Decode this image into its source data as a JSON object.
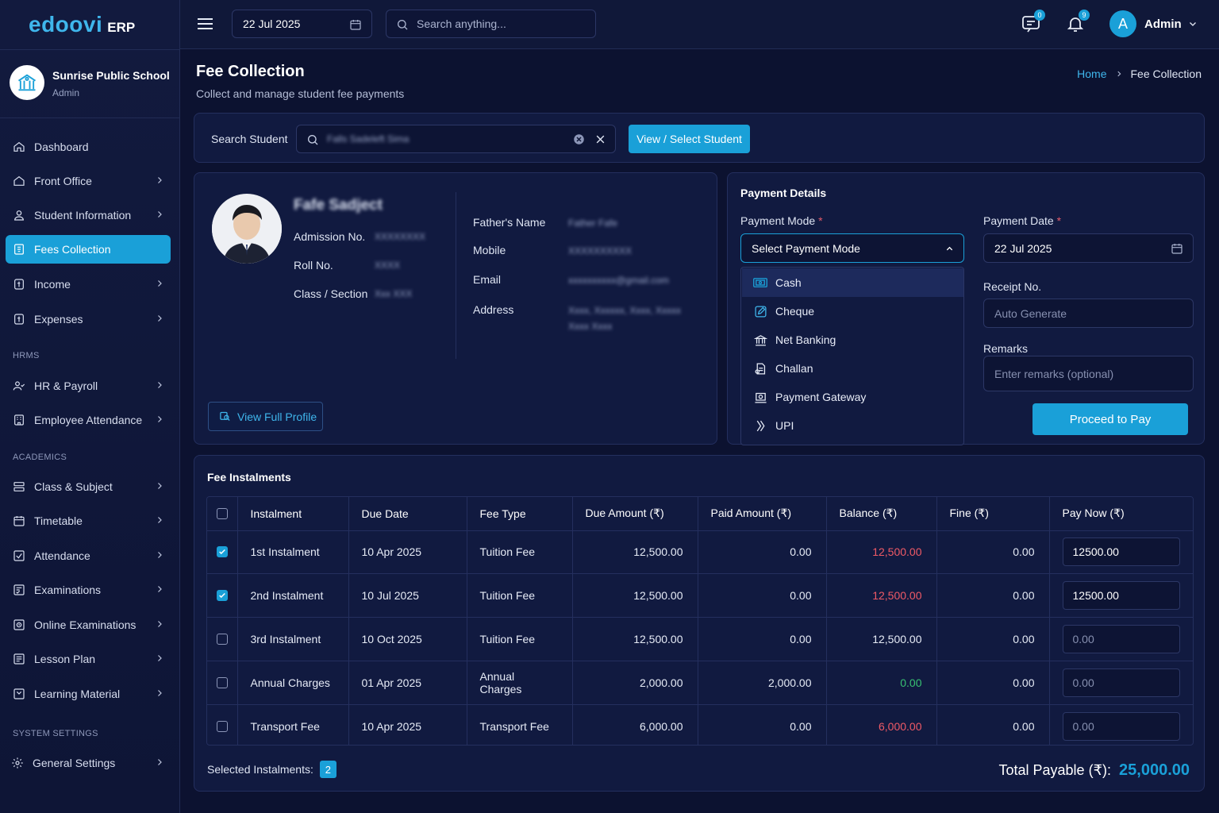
{
  "app": {
    "brand": "edoovi",
    "brand_suffix": "ERP"
  },
  "school": {
    "name": "Sunrise Public School",
    "role": "Admin"
  },
  "sidebar": {
    "items": [
      {
        "label": "Dashboard"
      },
      {
        "label": "Front Office"
      },
      {
        "label": "Student Information"
      },
      {
        "label": "Fees Collection"
      },
      {
        "label": "Income"
      },
      {
        "label": "Expenses"
      },
      {
        "label": "HR & Payroll"
      },
      {
        "label": "Employee Attendance"
      },
      {
        "label": "Class & Subject"
      },
      {
        "label": "Timetable"
      },
      {
        "label": "Attendance"
      },
      {
        "label": "Examinations"
      },
      {
        "label": "Online Examinations"
      },
      {
        "label": "Lesson Plan"
      },
      {
        "label": "Learning Material"
      },
      {
        "label": "General Settings"
      }
    ],
    "sections": [
      "HRMS",
      "ACADEMICS",
      "SYSTEM SETTINGS"
    ],
    "active": "Fees Collection"
  },
  "topbar": {
    "date": "22 Jul 2025",
    "search_placeholder": "Search anything...",
    "messages_count": "0",
    "notifications_count": "9",
    "user_initial": "A",
    "user_name": "Admin"
  },
  "page": {
    "title": "Fee Collection",
    "subtitle": "Collect and manage student fee payments",
    "breadcrumb_home": "Home",
    "breadcrumb_current": "Fee Collection"
  },
  "search": {
    "label": "Search Student",
    "value": "Falls Sadeleft Sima",
    "button": "View / Select Student"
  },
  "student": {
    "name": "Fafe Sadject",
    "admission_label": "Admission No.",
    "admission_value": "XXXXXXXX",
    "roll_label": "Roll No.",
    "roll_value": "XXXX",
    "class_label": "Class / Section",
    "class_value": "Xxx XXX",
    "father_label": "Father's Name",
    "father_value": "Father Fafe",
    "mobile_label": "Mobile",
    "mobile_value": "XXXXXXXXXX",
    "email_label": "Email",
    "email_value": "xxxxxxxxxx@gmail.com",
    "address_label": "Address",
    "address_line1": "Xxxx, Xxxxxx, Xxxx, Xxxxx",
    "address_line2": "Xxxx Xxxx",
    "view_profile": "View Full Profile"
  },
  "payment": {
    "title": "Payment Details",
    "mode_label": "Payment Mode",
    "mode_placeholder": "Select Payment Mode",
    "date_label": "Payment Date",
    "date_value": "22 Jul 2025",
    "receipt_label": "Receipt No.",
    "receipt_placeholder": "Auto Generate",
    "remarks_label": "Remarks",
    "remarks_placeholder": "Enter remarks (optional)",
    "proceed": "Proceed to Pay",
    "required_mark": "*",
    "options": [
      {
        "label": "Cash",
        "icon": "cash-icon"
      },
      {
        "label": "Cheque",
        "icon": "cheque-icon"
      },
      {
        "label": "Net Banking",
        "icon": "bank-icon"
      },
      {
        "label": "Challan",
        "icon": "challan-icon"
      },
      {
        "label": "Payment Gateway",
        "icon": "gateway-icon"
      },
      {
        "label": "UPI",
        "icon": "upi-icon"
      }
    ]
  },
  "instalments": {
    "title": "Fee Instalments",
    "columns": [
      "Instalment",
      "Due Date",
      "Fee Type",
      "Due Amount (₹)",
      "Paid Amount (₹)",
      "Balance (₹)",
      "Fine (₹)",
      "Pay Now (₹)"
    ],
    "rows": [
      {
        "checked": true,
        "name": "1st Instalment",
        "due_date": "10 Apr 2025",
        "fee_type": "Tuition Fee",
        "due": "12,500.00",
        "paid": "0.00",
        "balance": "12,500.00",
        "balance_color": "red",
        "fine": "0.00",
        "pay_now": "12500.00"
      },
      {
        "checked": true,
        "name": "2nd Instalment",
        "due_date": "10 Jul 2025",
        "fee_type": "Tuition Fee",
        "due": "12,500.00",
        "paid": "0.00",
        "balance": "12,500.00",
        "balance_color": "red",
        "fine": "0.00",
        "pay_now": "12500.00"
      },
      {
        "checked": false,
        "name": "3rd Instalment",
        "due_date": "10 Oct 2025",
        "fee_type": "Tuition Fee",
        "due": "12,500.00",
        "paid": "0.00",
        "balance": "12,500.00",
        "balance_color": "white",
        "fine": "0.00",
        "pay_now": "0.00"
      },
      {
        "checked": false,
        "name": "Annual Charges",
        "due_date": "01 Apr 2025",
        "fee_type": "Annual Charges",
        "due": "2,000.00",
        "paid": "2,000.00",
        "balance": "0.00",
        "balance_color": "green",
        "fine": "0.00",
        "pay_now": "0.00"
      },
      {
        "checked": false,
        "name": "Transport Fee",
        "due_date": "10 Apr 2025",
        "fee_type": "Transport Fee",
        "due": "6,000.00",
        "paid": "0.00",
        "balance": "6,000.00",
        "balance_color": "red",
        "fine": "0.00",
        "pay_now": "0.00"
      }
    ],
    "selected_label": "Selected Instalments:",
    "selected_count": "2",
    "total_label": "Total Payable (₹):",
    "total_value": "25,000.00"
  },
  "colors": {
    "accent": "#1aa0d8",
    "background": "#0c1230",
    "card": "#111a40",
    "danger": "#f05a66",
    "success": "#38c172"
  }
}
